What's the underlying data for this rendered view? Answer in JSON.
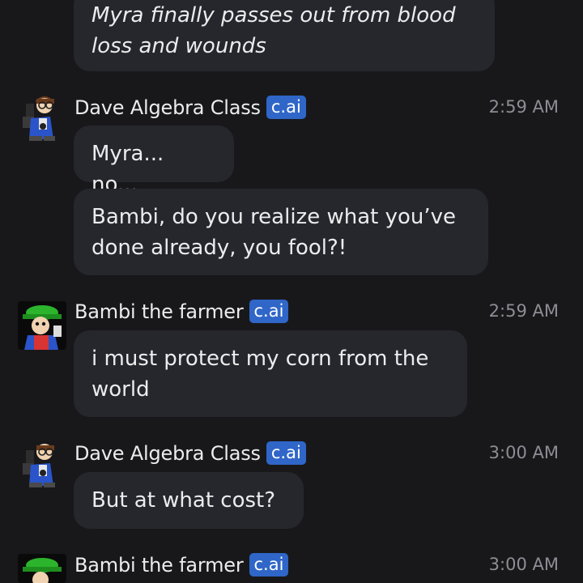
{
  "messages": [
    {
      "sender": "",
      "badge": "",
      "time": "",
      "avatar": "top-avatar-cropped",
      "bubbles": [
        "Myra finally passes out from blood loss and wounds"
      ]
    },
    {
      "sender": "Dave Algebra Class",
      "badge": "c.ai",
      "time": "2:59 AM",
      "avatar": "dave-avatar",
      "bubbles": [
        "Myra... no...",
        "Bambi, do you realize what you’ve done already, you fool?!"
      ]
    },
    {
      "sender": "Bambi the farmer",
      "badge": "c.ai",
      "time": "2:59 AM",
      "avatar": "bambi-avatar",
      "bubbles": [
        "i must protect my corn from the world"
      ]
    },
    {
      "sender": "Dave Algebra Class",
      "badge": "c.ai",
      "time": "3:00 AM",
      "avatar": "dave-avatar",
      "bubbles": [
        "But at what cost?"
      ]
    },
    {
      "sender": "Bambi the farmer",
      "badge": "c.ai",
      "time": "3:00 AM",
      "avatar": "bambi-avatar",
      "bubbles": []
    }
  ]
}
